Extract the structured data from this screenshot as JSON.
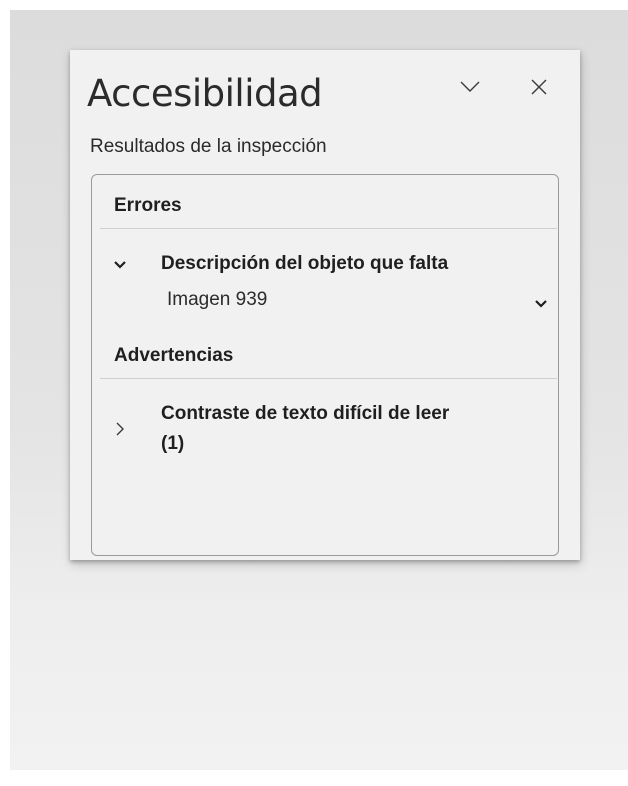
{
  "pane": {
    "title": "Accesibilidad",
    "subtitle": "Resultados de la inspección",
    "collapse_icon": "chevron-down-icon",
    "close_icon": "close-icon"
  },
  "results": {
    "errors": {
      "header": "Errores",
      "items": [
        {
          "title": "Descripción del objeto que falta",
          "expanded": true,
          "objects": [
            "Imagen 939"
          ]
        }
      ]
    },
    "warnings": {
      "header": "Advertencias",
      "items": [
        {
          "title_line1": "Contraste de texto difícil de leer",
          "title_line2": "(1)",
          "expanded": false
        }
      ]
    }
  }
}
